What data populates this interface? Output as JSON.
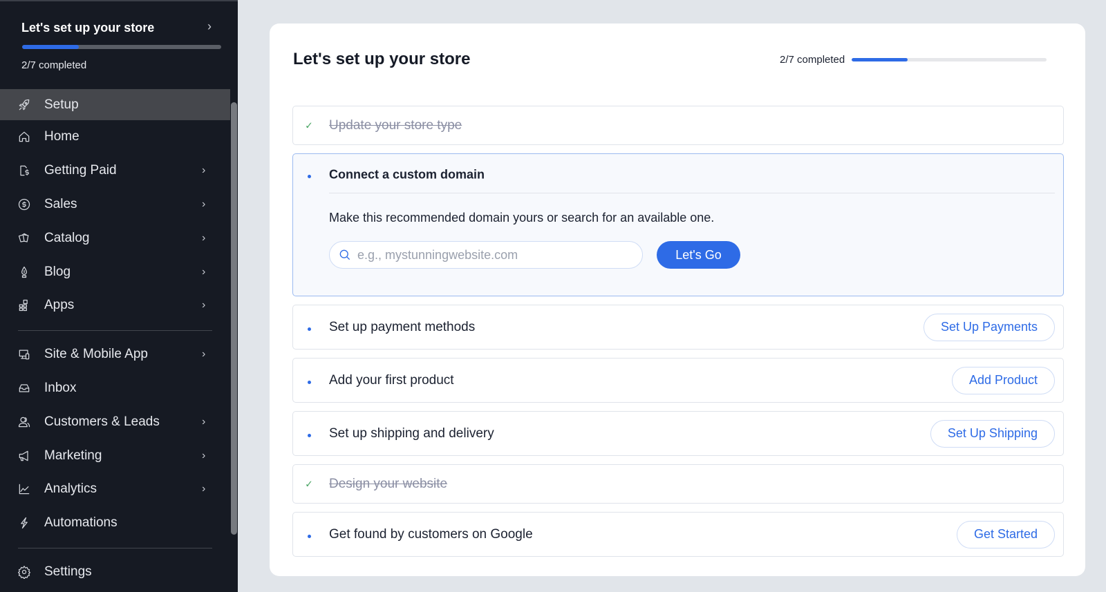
{
  "sidebar": {
    "setup_card": {
      "title": "Let's set up your store",
      "completed_text": "2/7 completed",
      "progress": 0.2857
    },
    "items": [
      {
        "label": "Setup",
        "icon": "rocket-icon",
        "active": true,
        "has_submenu": false
      },
      {
        "label": "Home",
        "icon": "home-icon",
        "has_submenu": false
      },
      {
        "label": "Getting Paid",
        "icon": "invoice-dollar-icon",
        "has_submenu": true
      },
      {
        "label": "Sales",
        "icon": "dollar-circle-icon",
        "has_submenu": true
      },
      {
        "label": "Catalog",
        "icon": "catalog-icon",
        "has_submenu": true
      },
      {
        "label": "Blog",
        "icon": "pen-nib-icon",
        "has_submenu": true
      },
      {
        "label": "Apps",
        "icon": "apps-grid-icon",
        "has_submenu": true
      },
      {
        "label": "Site & Mobile App",
        "icon": "devices-icon",
        "has_submenu": true
      },
      {
        "label": "Inbox",
        "icon": "inbox-icon",
        "has_submenu": false
      },
      {
        "label": "Customers & Leads",
        "icon": "users-icon",
        "has_submenu": true
      },
      {
        "label": "Marketing",
        "icon": "megaphone-icon",
        "has_submenu": true
      },
      {
        "label": "Analytics",
        "icon": "chart-line-icon",
        "has_submenu": true
      },
      {
        "label": "Automations",
        "icon": "lightning-icon",
        "has_submenu": false
      },
      {
        "label": "Settings",
        "icon": "gear-icon",
        "has_submenu": false
      }
    ]
  },
  "main": {
    "title": "Let's set up your store",
    "completed_text": "2/7 completed",
    "progress": 0.2857,
    "tasks": [
      {
        "label": "Update your store type",
        "status": "done"
      },
      {
        "label": "Connect a custom domain",
        "status": "expanded",
        "description": "Make this recommended domain yours or search for an available one.",
        "input_placeholder": "e.g., mystunningwebsite.com",
        "input_value": "",
        "button_label": "Let's Go"
      },
      {
        "label": "Set up payment methods",
        "status": "todo",
        "button_label": "Set Up Payments"
      },
      {
        "label": "Add your first product",
        "status": "todo",
        "button_label": "Add Product"
      },
      {
        "label": "Set up shipping and delivery",
        "status": "todo",
        "button_label": "Set Up Shipping"
      },
      {
        "label": "Design your website",
        "status": "done"
      },
      {
        "label": "Get found by customers on Google",
        "status": "todo",
        "button_label": "Get Started"
      }
    ]
  },
  "colors": {
    "accent": "#2e6be6",
    "sidebar_bg": "#161a23",
    "check": "#4aa564"
  }
}
